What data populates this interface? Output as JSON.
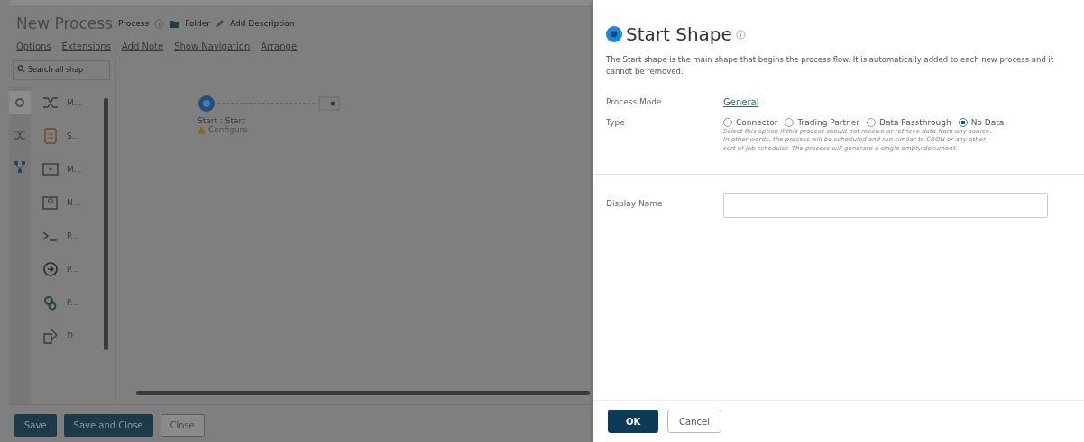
{
  "editor": {
    "title": "New Process",
    "type_label": "Process",
    "folder": "Folder",
    "add_description": "Add Description",
    "menu": [
      "Options",
      "Extensions",
      "Add Note",
      "Show Navigation",
      "Arrange"
    ],
    "search": {
      "placeholder": "Search all shap"
    },
    "side_tabs": [
      {
        "kind": "gear",
        "selected": true
      },
      {
        "kind": "shuffle",
        "selected": false
      },
      {
        "kind": "flow",
        "selected": false
      }
    ],
    "shapes": [
      {
        "kind": "shuffle",
        "label": "M..."
      },
      {
        "kind": "db",
        "label": "S..."
      },
      {
        "kind": "message",
        "label": "M..."
      },
      {
        "kind": "note",
        "label": "N..."
      },
      {
        "kind": "route",
        "label": "P..."
      },
      {
        "kind": "target",
        "label": "P..."
      },
      {
        "kind": "gears",
        "label": "P..."
      },
      {
        "kind": "decision",
        "label": "D..."
      }
    ],
    "node": {
      "label": "Start : Start",
      "action": "Configure"
    },
    "buttons": [
      {
        "label": "Save",
        "kind": "primary"
      },
      {
        "label": "Save and Close",
        "kind": "primary"
      },
      {
        "label": "Close",
        "kind": "secondary"
      }
    ]
  },
  "panel": {
    "title": "Start Shape",
    "description": "The Start shape is the main shape that begins the process flow. It is automatically added to each new process and it cannot be removed.",
    "process_mode": {
      "label": "Process Mode",
      "value": "General"
    },
    "type": {
      "label": "Type",
      "options": [
        {
          "label": "Connector",
          "selected": false
        },
        {
          "label": "Trading Partner",
          "selected": false
        },
        {
          "label": "Data Passthrough",
          "selected": false
        },
        {
          "label": "No Data",
          "selected": true
        }
      ],
      "help": "Select this option if this process should not receive or retrieve data from any source. In other words, the process will be scheduled and run similar to CRON or any other sort of job scheduler. The process will generate a single empty document."
    },
    "display_name": {
      "label": "Display Name"
    },
    "buttons": [
      {
        "label": "OK",
        "kind": "primary"
      },
      {
        "label": "Cancel",
        "kind": "secondary"
      }
    ]
  }
}
